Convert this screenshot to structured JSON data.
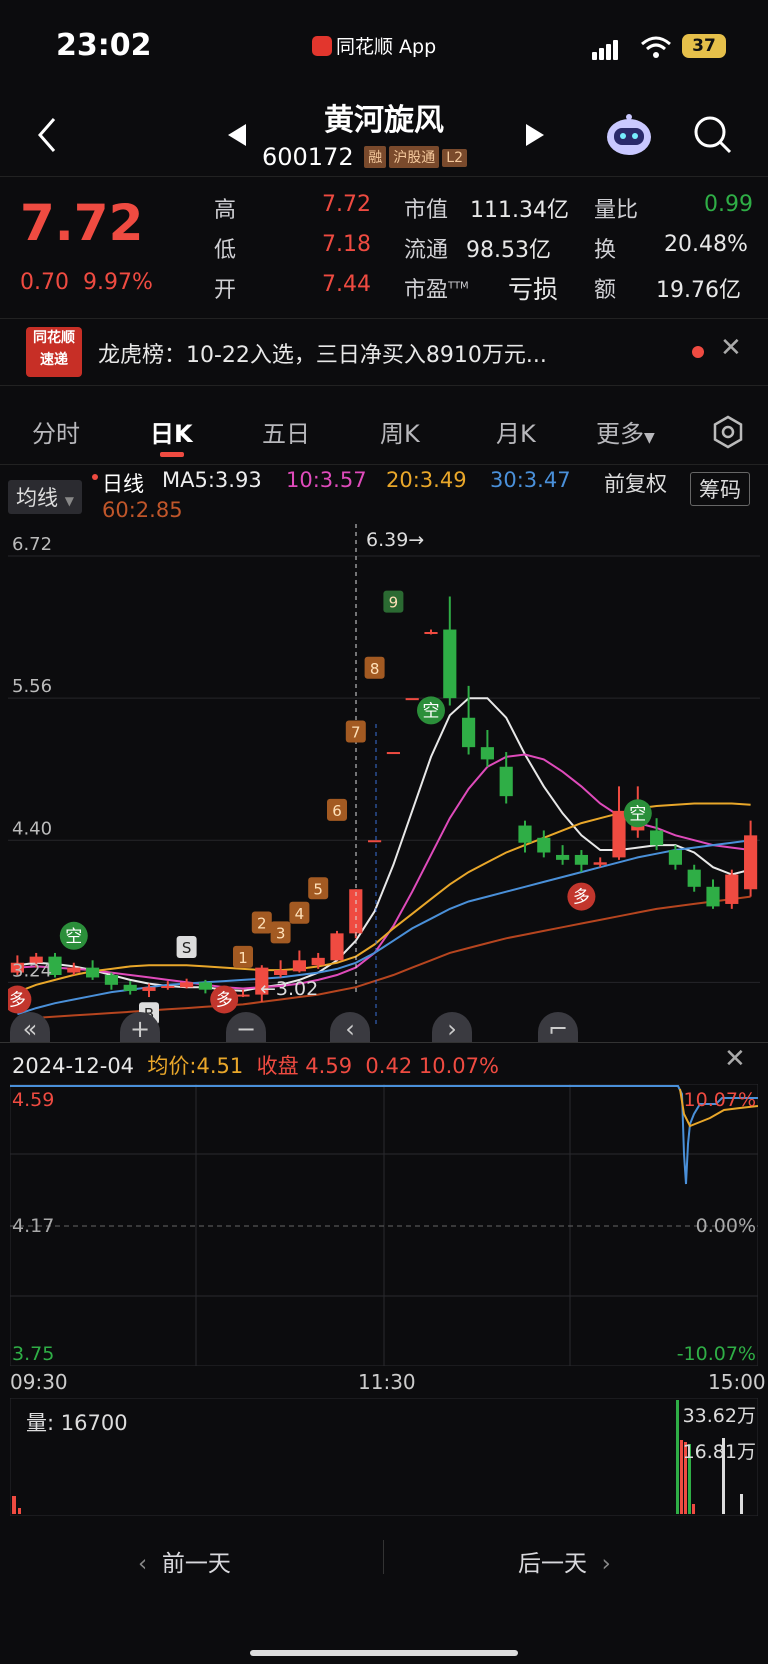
{
  "status_bar": {
    "time": "23:02",
    "app_name": "同花顺 App",
    "battery": "37"
  },
  "header": {
    "title": "黄河旋风",
    "code": "600172",
    "tags": [
      "融",
      "沪股通",
      "L2"
    ],
    "prev_icon": "triangle-left-icon",
    "next_icon": "triangle-right-icon"
  },
  "quote": {
    "price": "7.72",
    "change": "0.70",
    "change_pct": "9.97%",
    "rows": [
      {
        "l1": "高",
        "v1": "7.72",
        "l2": "市值",
        "v2": "111.34亿",
        "l3": "量比",
        "v3": "0.99"
      },
      {
        "l1": "低",
        "v1": "7.18",
        "l2": "流通",
        "v2": "98.53亿",
        "l3": "换",
        "v3": "20.48%"
      },
      {
        "l1": "开",
        "v1": "7.44",
        "l2": "市盈",
        "l2_sup": "TTM",
        "v2": "亏损",
        "l3": "额",
        "v3": "19.76亿"
      }
    ]
  },
  "news": {
    "badge_line1": "同花顺",
    "badge_line2": "速递",
    "text": "龙虎榜：10-22入选，三日净买入8910万元..."
  },
  "tabs": [
    "分时",
    "日K",
    "五日",
    "周K",
    "月K",
    "更多"
  ],
  "legend": {
    "mode": "均线",
    "line_type": "日线",
    "ma5": "MA5:3.93",
    "ma10": "10:3.57",
    "ma20": "20:3.49",
    "ma30": "30:3.47",
    "ma60": "60:2.85",
    "adjust": "前复权",
    "chips": "筹码"
  },
  "kline": {
    "y_labels": [
      "6.72",
      "5.56",
      "4.40",
      "3.24"
    ],
    "high_mark": "6.39→",
    "low_mark": "←3.02",
    "markers": {
      "kong": "空",
      "duo": "多",
      "buy": "B",
      "sell": "S"
    },
    "count_labels": [
      "1",
      "2",
      "3",
      "4",
      "5",
      "6",
      "7",
      "8",
      "9"
    ]
  },
  "chart_data": {
    "type": "candlestick",
    "ylim": [
      2.9,
      6.9
    ],
    "candles": [
      {
        "o": 3.32,
        "c": 3.4,
        "h": 3.46,
        "l": 3.3
      },
      {
        "o": 3.4,
        "c": 3.45,
        "h": 3.48,
        "l": 3.36
      },
      {
        "o": 3.45,
        "c": 3.3,
        "h": 3.48,
        "l": 3.28
      },
      {
        "o": 3.32,
        "c": 3.36,
        "h": 3.4,
        "l": 3.3
      },
      {
        "o": 3.36,
        "c": 3.28,
        "h": 3.42,
        "l": 3.26
      },
      {
        "o": 3.3,
        "c": 3.22,
        "h": 3.32,
        "l": 3.18
      },
      {
        "o": 3.22,
        "c": 3.17,
        "h": 3.25,
        "l": 3.14
      },
      {
        "o": 3.17,
        "c": 3.2,
        "h": 3.23,
        "l": 3.12
      },
      {
        "o": 3.2,
        "c": 3.21,
        "h": 3.25,
        "l": 3.18
      },
      {
        "o": 3.2,
        "c": 3.24,
        "h": 3.27,
        "l": 3.19
      },
      {
        "o": 3.24,
        "c": 3.18,
        "h": 3.26,
        "l": 3.15
      },
      {
        "o": 3.18,
        "c": 3.14,
        "h": 3.2,
        "l": 3.1
      },
      {
        "o": 3.14,
        "c": 3.14,
        "h": 3.18,
        "l": 3.12
      },
      {
        "o": 3.14,
        "c": 3.36,
        "h": 3.38,
        "l": 3.08
      },
      {
        "o": 3.3,
        "c": 3.34,
        "h": 3.42,
        "l": 3.28
      },
      {
        "o": 3.33,
        "c": 3.42,
        "h": 3.5,
        "l": 3.32
      },
      {
        "o": 3.38,
        "c": 3.44,
        "h": 3.48,
        "l": 3.35
      },
      {
        "o": 3.42,
        "c": 3.64,
        "h": 3.66,
        "l": 3.42
      },
      {
        "o": 3.64,
        "c": 4.0,
        "h": 4.0,
        "l": 3.6
      },
      {
        "o": 4.4,
        "c": 4.4,
        "h": 4.4,
        "l": 4.4
      },
      {
        "o": 5.12,
        "c": 5.12,
        "h": 5.12,
        "l": 5.12
      },
      {
        "o": 5.56,
        "c": 5.56,
        "h": 5.56,
        "l": 5.56
      },
      {
        "o": 6.1,
        "c": 6.1,
        "h": 6.12,
        "l": 6.08
      },
      {
        "o": 6.12,
        "c": 5.56,
        "h": 6.39,
        "l": 5.5
      },
      {
        "o": 5.4,
        "c": 5.16,
        "h": 5.66,
        "l": 5.1
      },
      {
        "o": 5.16,
        "c": 5.06,
        "h": 5.3,
        "l": 5.0
      },
      {
        "o": 5.0,
        "c": 4.76,
        "h": 5.12,
        "l": 4.7
      },
      {
        "o": 4.52,
        "c": 4.38,
        "h": 4.56,
        "l": 4.3
      },
      {
        "o": 4.42,
        "c": 4.3,
        "h": 4.48,
        "l": 4.26
      },
      {
        "o": 4.28,
        "c": 4.24,
        "h": 4.36,
        "l": 4.2
      },
      {
        "o": 4.28,
        "c": 4.2,
        "h": 4.32,
        "l": 4.14
      },
      {
        "o": 4.2,
        "c": 4.22,
        "h": 4.26,
        "l": 4.18
      },
      {
        "o": 4.26,
        "c": 4.64,
        "h": 4.84,
        "l": 4.24
      },
      {
        "o": 4.48,
        "c": 4.52,
        "h": 4.84,
        "l": 4.42
      },
      {
        "o": 4.48,
        "c": 4.36,
        "h": 4.58,
        "l": 4.32
      },
      {
        "o": 4.32,
        "c": 4.2,
        "h": 4.36,
        "l": 4.16
      },
      {
        "o": 4.16,
        "c": 4.02,
        "h": 4.2,
        "l": 3.98
      },
      {
        "o": 4.02,
        "c": 3.86,
        "h": 4.08,
        "l": 3.84
      },
      {
        "o": 3.88,
        "c": 4.12,
        "h": 4.16,
        "l": 3.84
      },
      {
        "o": 4.0,
        "c": 4.44,
        "h": 4.56,
        "l": 3.94
      }
    ],
    "ma_lines": [
      {
        "name": "MA5",
        "color": "#e8e8e8",
        "values": [
          3.38,
          3.4,
          3.39,
          3.37,
          3.34,
          3.3,
          3.26,
          3.23,
          3.21,
          3.2,
          3.2,
          3.18,
          3.17,
          3.2,
          3.22,
          3.26,
          3.32,
          3.42,
          3.58,
          3.82,
          4.2,
          4.64,
          5.08,
          5.42,
          5.56,
          5.56,
          5.4,
          5.1,
          4.84,
          4.62,
          4.44,
          4.32,
          4.32,
          4.34,
          4.36,
          4.36,
          4.3,
          4.18,
          4.12,
          4.16
        ]
      },
      {
        "name": "MA10",
        "color": "#df4bbb",
        "values": [
          3.36,
          3.37,
          3.36,
          3.35,
          3.34,
          3.32,
          3.3,
          3.28,
          3.26,
          3.24,
          3.22,
          3.2,
          3.19,
          3.2,
          3.21,
          3.23,
          3.26,
          3.3,
          3.36,
          3.48,
          3.7,
          3.98,
          4.28,
          4.58,
          4.82,
          5.0,
          5.08,
          5.1,
          5.06,
          4.96,
          4.84,
          4.7,
          4.6,
          4.54,
          4.5,
          4.44,
          4.4,
          4.36,
          4.34,
          4.32
        ]
      },
      {
        "name": "MA20",
        "color": "#e9a72a",
        "values": [
          3.16,
          3.22,
          3.26,
          3.3,
          3.33,
          3.35,
          3.37,
          3.38,
          3.38,
          3.38,
          3.37,
          3.36,
          3.35,
          3.34,
          3.34,
          3.35,
          3.37,
          3.4,
          3.45,
          3.55,
          3.68,
          3.8,
          3.92,
          4.04,
          4.14,
          4.22,
          4.3,
          4.36,
          4.42,
          4.48,
          4.54,
          4.58,
          4.62,
          4.66,
          4.68,
          4.69,
          4.7,
          4.7,
          4.7,
          4.69
        ]
      },
      {
        "name": "MA30",
        "color": "#4a90d9",
        "values": [
          2.98,
          3.03,
          3.07,
          3.1,
          3.13,
          3.16,
          3.18,
          3.2,
          3.22,
          3.23,
          3.24,
          3.25,
          3.26,
          3.27,
          3.28,
          3.3,
          3.32,
          3.35,
          3.4,
          3.48,
          3.58,
          3.68,
          3.76,
          3.84,
          3.9,
          3.94,
          3.98,
          4.02,
          4.06,
          4.1,
          4.14,
          4.18,
          4.22,
          4.26,
          4.29,
          4.32,
          4.34,
          4.36,
          4.38,
          4.4
        ]
      },
      {
        "name": "MA60",
        "color": "#b6451f",
        "values": [
          2.94,
          2.95,
          2.96,
          2.97,
          2.98,
          2.99,
          3.0,
          3.01,
          3.02,
          3.03,
          3.04,
          3.05,
          3.06,
          3.08,
          3.1,
          3.12,
          3.14,
          3.17,
          3.2,
          3.25,
          3.3,
          3.36,
          3.42,
          3.48,
          3.52,
          3.56,
          3.6,
          3.63,
          3.66,
          3.69,
          3.72,
          3.75,
          3.78,
          3.81,
          3.84,
          3.86,
          3.88,
          3.9,
          3.92,
          3.94
        ]
      }
    ]
  },
  "controls": [
    "«",
    "+",
    "−",
    "‹",
    "›",
    "⌐"
  ],
  "intraday": {
    "date": "2024-12-04",
    "avg_label": "均价:",
    "avg": "4.51",
    "close_label": "收盘",
    "close": "4.59",
    "change": "0.42",
    "change_pct": "10.07%",
    "y_left": [
      "4.59",
      "4.17",
      "3.75"
    ],
    "y_right": [
      "10.07%",
      "0.00%",
      "-10.07%"
    ],
    "x_labels": [
      "09:30",
      "11:30",
      "15:00"
    ],
    "volume_label": "量: 16700",
    "vol_right": [
      "33.62万",
      "16.81万"
    ]
  },
  "bottom_nav": {
    "prev": "前一天",
    "next": "后一天"
  }
}
